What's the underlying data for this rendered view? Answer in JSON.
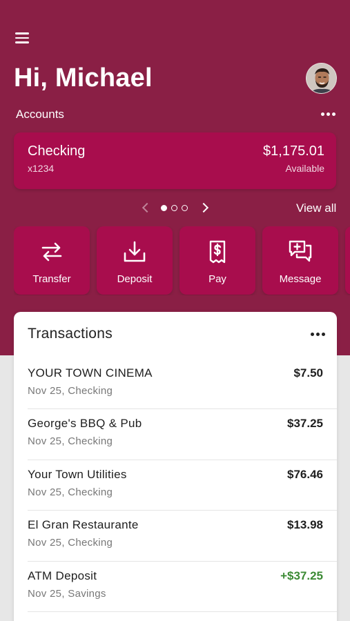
{
  "header": {
    "greeting": "Hi, Michael",
    "menu_icon": "menu-icon",
    "avatar_icon": "avatar"
  },
  "accounts": {
    "label": "Accounts",
    "card": {
      "name": "Checking",
      "number": "x1234",
      "balance": "$1,175.01",
      "balance_label": "Available"
    },
    "pager": {
      "current": 1,
      "total": 3
    },
    "view_all_label": "View all"
  },
  "actions": [
    {
      "label": "Transfer",
      "icon": "transfer-icon"
    },
    {
      "label": "Deposit",
      "icon": "deposit-icon"
    },
    {
      "label": "Pay",
      "icon": "pay-icon"
    },
    {
      "label": "Message",
      "icon": "message-icon"
    }
  ],
  "transactions": {
    "title": "Transactions",
    "items": [
      {
        "name": "YOUR TOWN CINEMA",
        "meta": "Nov 25, Checking",
        "amount": "$7.50",
        "credit": false
      },
      {
        "name": "George's BBQ & Pub",
        "meta": "Nov 25, Checking",
        "amount": "$37.25",
        "credit": false
      },
      {
        "name": "Your Town Utilities",
        "meta": "Nov 25, Checking",
        "amount": "$76.46",
        "credit": false
      },
      {
        "name": "El Gran Restaurante",
        "meta": "Nov 25, Checking",
        "amount": "$13.98",
        "credit": false
      },
      {
        "name": "ATM Deposit",
        "meta": "Nov 25, Savings",
        "amount": "+$37.25",
        "credit": true
      }
    ]
  },
  "colors": {
    "brand": "#8a1f45",
    "card": "#a80d4d",
    "credit": "#3b8a34"
  }
}
